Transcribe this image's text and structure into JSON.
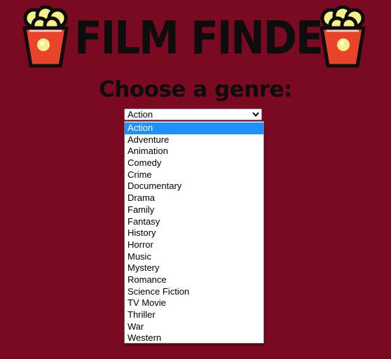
{
  "header": {
    "title": "FILM FINDER",
    "left_logo_icon": "popcorn-icon",
    "right_logo_icon": "popcorn-icon"
  },
  "subtitle": "Choose a genre:",
  "genre_select": {
    "selected_value": "Action",
    "arrow_icon": "chevron-down-icon",
    "options": [
      "Action",
      "Adventure",
      "Animation",
      "Comedy",
      "Crime",
      "Documentary",
      "Drama",
      "Family",
      "Fantasy",
      "History",
      "Horror",
      "Music",
      "Mystery",
      "Romance",
      "Science Fiction",
      "TV Movie",
      "Thriller",
      "War",
      "Western"
    ],
    "highlighted_index": 0
  },
  "colors": {
    "background": "#7a0a21",
    "title_text": "#0d0d0d",
    "highlight": "#1e90ff",
    "popcorn_box": "#e8442a",
    "popcorn_kernels": "#f6f08a"
  }
}
